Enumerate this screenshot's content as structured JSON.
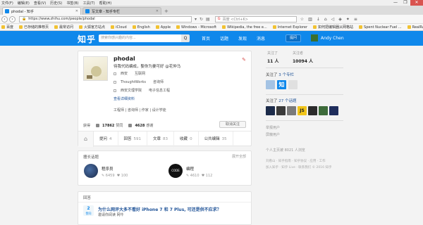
{
  "browser": {
    "menu": [
      "文件(F)",
      "编辑(E)",
      "查看(V)",
      "历史(S)",
      "书签(B)",
      "工具(T)",
      "帮助(H)"
    ],
    "controls": [
      "—",
      "❐",
      "✕"
    ],
    "tabs": [
      {
        "label": "phodal - 知乎",
        "active": true
      },
      {
        "label": "写文章 - 知乎专栏",
        "active": false
      }
    ],
    "new_tab": "+",
    "url": "https://www.zhihu.com/people/phodal",
    "search_placeholder": "百度 <Ctrl+K>",
    "search_engine": "G",
    "bookmarks": [
      "百度",
      "已存储的推荐页",
      "最常访问",
      "火狐官方站点",
      "iCloud",
      "English",
      "Apple",
      "Windows - Microsoft",
      "Wikipedia, the free e...",
      "Internet Explorer",
      "如何把编辑器从网格站",
      "Spent Nuclear Fuel ...",
      "RealRailway.com"
    ]
  },
  "zhihu": {
    "logo": "知乎",
    "search_placeholder": "搜索你感兴趣的内容...",
    "search_button": "Q",
    "nav": [
      "首页",
      "话题",
      "发现",
      "消息"
    ],
    "ask": "提问",
    "user": "Andy Chen"
  },
  "profile": {
    "name": "phodal",
    "bio": "待我代码编成，娶你为妻可好 @花仲马",
    "location": "西安",
    "industry": "互联网",
    "company": "ThoughtWorks",
    "position": "咨询师",
    "school": "西安文理学院",
    "major": "电子信息工程",
    "more": "查看详细资料",
    "tags": "工程师 | 咨询师 | 作家 | 设计学徒",
    "votes_label": "获得",
    "votes": "17862",
    "votes_suffix": "赞同",
    "thanks": "4628",
    "thanks_suffix": "感谢",
    "unfollow": "取消关注",
    "edit_icon": "pencil-icon"
  },
  "tabs": [
    {
      "label": "提问",
      "count": "4"
    },
    {
      "label": "回答",
      "count": "591"
    },
    {
      "label": "文章",
      "count": "83"
    },
    {
      "label": "收藏",
      "count": "0"
    },
    {
      "label": "公共编辑",
      "count": "35"
    }
  ],
  "followed_topics": {
    "title": "擅长话题",
    "more": "展开全部",
    "items": [
      {
        "name": "程序员",
        "answers": "6459",
        "votes": "100",
        "color": "#1c2b4a"
      },
      {
        "name": "编程",
        "answers": "4610",
        "votes": "112",
        "color": "#111111"
      }
    ]
  },
  "answers": {
    "title": "回答",
    "votes": "2",
    "votes_label": "赞同",
    "question": "为什么网评大多不看好 iPhone 7 和 7 Plus, 可还是供不应求？",
    "excerpt": "邀请你阅读 网牛"
  },
  "sidebar": {
    "following_label": "关注了",
    "following": "11 人",
    "followers_label": "关注者",
    "followers": "10094 人",
    "columns_text": "关注了",
    "columns_link": "3 个专栏",
    "topics_text": "关注了",
    "topics_link": "27 个话题",
    "links": [
      "举报用户",
      "屏蔽用户"
    ],
    "views": "个人主页被 8021 人浏览",
    "footer1": "刘看山 · 知乎指南 · 知乎协议 · 应用 · 工作",
    "footer2": "加入知乎 · 知乎 Live · 联系我们 © 2016 知乎",
    "column_colors": [
      "#a4c3e4",
      "#0f88eb",
      "#e0e0e0"
    ],
    "topic_colors": [
      "#1c2b4a",
      "#3a3a3a",
      "#7a7a7a",
      "#f0c419",
      "#2b2b2b",
      "#3d6b3a",
      "#1f2d5c"
    ]
  }
}
